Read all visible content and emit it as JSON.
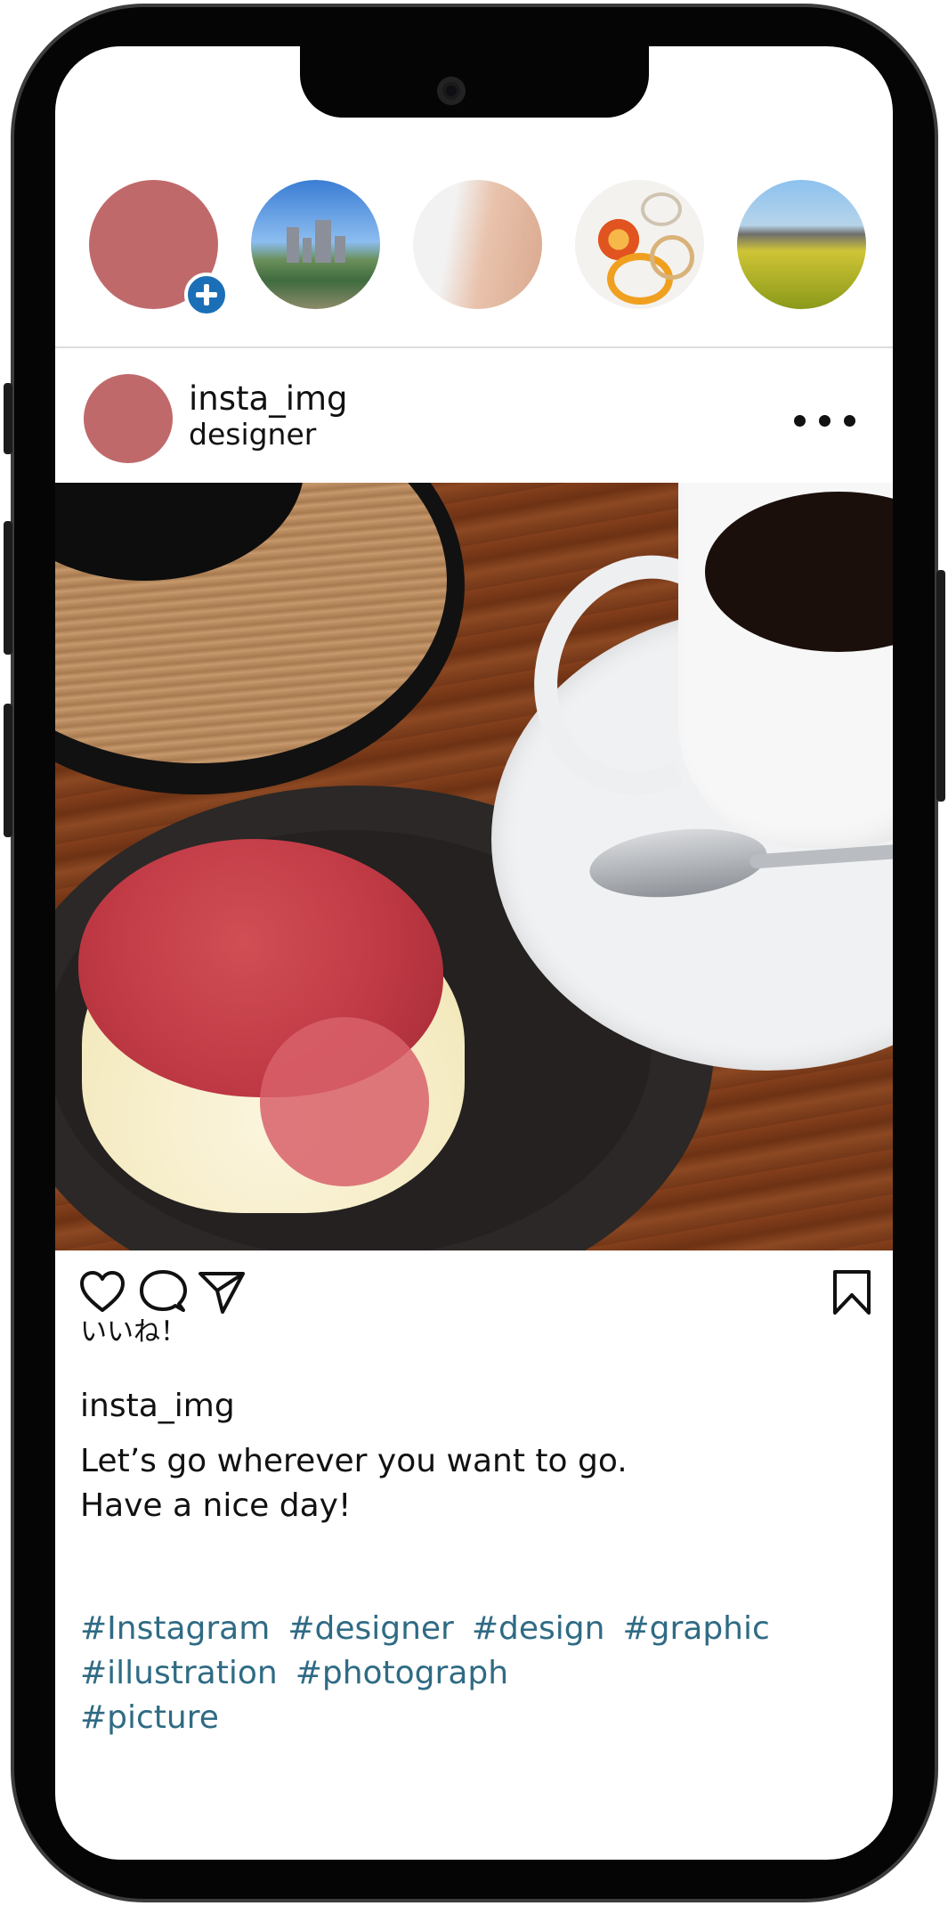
{
  "stories": [
    {
      "name": "own-story",
      "badge_icon": "plus-icon",
      "color": "#c0696b"
    },
    {
      "name": "story-city",
      "subject": "city skyline"
    },
    {
      "name": "story-earring",
      "subject": "earring portrait"
    },
    {
      "name": "story-rings",
      "subject": "rings"
    },
    {
      "name": "story-field",
      "subject": "flower field"
    }
  ],
  "post": {
    "username": "insta_img",
    "subtitle": "designer",
    "more_icon": "more-dots-icon",
    "image_subject": "cake and coffee"
  },
  "actions": {
    "like_icon": "heart-icon",
    "comment_icon": "comment-icon",
    "share_icon": "send-icon",
    "save_icon": "bookmark-icon",
    "likes_label": "いいね！"
  },
  "caption": {
    "username": "insta_img",
    "line1": "Let’s go wherever you want to go.",
    "line2": "Have a nice day!"
  },
  "hashtags": [
    "#Instagram",
    "#designer",
    "#design",
    "#graphic",
    "#illustration",
    "#photograph",
    "#picture"
  ],
  "colors": {
    "avatar": "#c0696b",
    "hashtag": "#2f6b84",
    "badge": "#1b6fb6"
  }
}
